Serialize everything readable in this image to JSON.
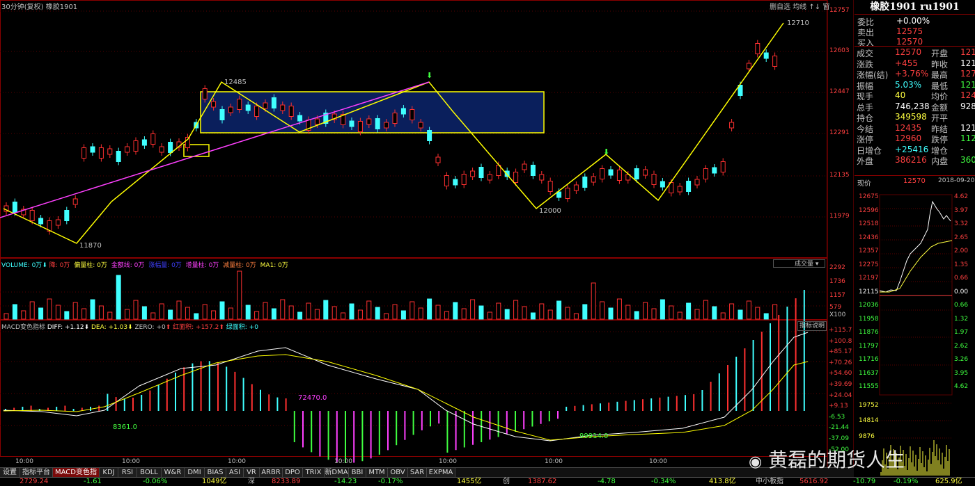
{
  "header": {
    "period": "30分钟(复权)",
    "symbol": "橡胶1901",
    "buttons": [
      "删自选",
      "均线",
      "↑↓",
      "窗"
    ]
  },
  "price_axis": [
    "12757",
    "12603",
    "12447",
    "12291",
    "12135",
    "11979"
  ],
  "chart_labels": {
    "high": "12710",
    "h1": "12485",
    "low1": "11870",
    "low2": "12000"
  },
  "volume": {
    "label": "VOLUME: 0万",
    "items": [
      {
        "text": "降: 0万",
        "color": "#ff4040"
      },
      {
        "text": "偏量柱: 0万",
        "color": "#ffff40"
      },
      {
        "text": "金额线: 0万",
        "color": "#ff40ff"
      },
      {
        "text": "涨幅量: 0万",
        "color": "#4040ff"
      },
      {
        "text": "增量柱: 0万",
        "color": "#ff40ff"
      },
      {
        "text": "减量柱: 0万",
        "color": "#ff8040"
      },
      {
        "text": "MA1: 0万",
        "color": "#ffff40"
      }
    ],
    "dropdown": "成交量",
    "axis": [
      "2292",
      "1736",
      "1157",
      "579",
      "X100"
    ]
  },
  "macd": {
    "title": "MACD变色指标",
    "diff": "DIFF: +1.12",
    "dea": "DEA: +1.03",
    "zero": "ZERO: +0",
    "red_area": "红面积: +157.2",
    "green_area": "绿面积: +0",
    "help": "指标说明",
    "axis": [
      "+115.7",
      "+100.8",
      "+85.17",
      "+70.26",
      "+54.60",
      "+39.69",
      "+24.04",
      "+9.13",
      "-6.53",
      "-21.44",
      "-37.09",
      "-52.00"
    ],
    "annotations": [
      "72470.0",
      "8361.0",
      "99914.0"
    ]
  },
  "time_axis": [
    "10:00",
    "10:00",
    "10:00",
    "10:00",
    "10:00",
    "10:00",
    "10:00"
  ],
  "tabs": [
    "设置",
    "指标平台",
    "MACD变色指标",
    "KDJ",
    "RSI",
    "BOLL",
    "W&R",
    "DMI",
    "BIAS",
    "ASI",
    "VR",
    "ARBR",
    "DPO",
    "TRIX",
    "新DMA",
    "BBI",
    "MTM",
    "OBV",
    "SAR",
    "EXPMA"
  ],
  "quote": {
    "title": "橡胶1901 ru1901",
    "top": [
      {
        "label": "委比",
        "value": "+0.00%",
        "vcolor": "#ffffff"
      },
      {
        "label": "卖出",
        "value": "12575",
        "vcolor": "#ff4040"
      },
      {
        "label": "买入",
        "value": "12570",
        "vcolor": "#ff4040"
      }
    ],
    "rows": [
      {
        "l1": "成交",
        "v1": "12570",
        "c1": "#ff4040",
        "l2": "开盘",
        "v2": "121",
        "c2": "#ff4040"
      },
      {
        "l1": "涨跌",
        "v1": "+455",
        "c1": "#ff4040",
        "l2": "昨收",
        "v2": "121",
        "c2": "#ffffff"
      },
      {
        "l1": "涨幅(结)",
        "v1": "+3.76%",
        "c1": "#ff4040",
        "l2": "最高",
        "v2": "127",
        "c2": "#ff4040"
      },
      {
        "l1": "振幅",
        "v1": "5.03%",
        "c1": "#40ffff",
        "l2": "最低",
        "v2": "121",
        "c2": "#40ff40"
      },
      {
        "l1": "现手",
        "v1": "40",
        "c1": "#ffff40",
        "l2": "均价",
        "v2": "124",
        "c2": "#ff4040"
      },
      {
        "l1": "总手",
        "v1": "746,238",
        "c1": "#ffffff",
        "l2": "金额",
        "v2": "928.3",
        "c2": "#ffffff"
      },
      {
        "l1": "持仓",
        "v1": "349598",
        "c1": "#ffff40",
        "l2": "开平",
        "v2": "",
        "c2": "#ffffff"
      },
      {
        "l1": "今结",
        "v1": "12435",
        "c1": "#ff4040",
        "l2": "昨结",
        "v2": "121",
        "c2": "#ffffff"
      },
      {
        "l1": "涨停",
        "v1": "12960",
        "c1": "#ff4040",
        "l2": "跌停",
        "v2": "112",
        "c2": "#40ff40"
      },
      {
        "l1": "日增仓",
        "v1": "+25416",
        "c1": "#40ffff",
        "l2": "增仓",
        "v2": "-",
        "c2": "#ffffff"
      },
      {
        "l1": "外盘",
        "v1": "386216",
        "c1": "#ff4040",
        "l2": "内盘",
        "v2": "3600",
        "c2": "#40ff40"
      }
    ],
    "current_label": "现价",
    "current_value": "12570",
    "date": "2018-09-20",
    "mini_left": [
      "12675",
      "12596",
      "12518",
      "12436",
      "12357",
      "12275",
      "12197",
      "12115",
      "12036",
      "11958",
      "11876",
      "11797",
      "11716",
      "11637",
      "11555"
    ],
    "mini_right": [
      "4.62",
      "3.97",
      "3.32",
      "2.65",
      "2.00",
      "1.35",
      "0.66",
      "0.00",
      "0.66",
      "1.32",
      "1.97",
      "2.62",
      "3.26",
      "3.95",
      "4.62"
    ],
    "mini_vol": [
      "19752",
      "14814",
      "9876"
    ]
  },
  "status_bar": [
    {
      "text": "2729.24",
      "color": "#ff4040"
    },
    {
      "text": "-1.61",
      "color": "#40ff40"
    },
    {
      "text": "-0.06%",
      "color": "#40ff40"
    },
    {
      "text": "1049亿",
      "color": "#ffff40"
    },
    {
      "text": "深",
      "color": "#c0c0c0"
    },
    {
      "text": "8233.89",
      "color": "#ff4040"
    },
    {
      "text": "-14.23",
      "color": "#40ff40"
    },
    {
      "text": "-0.17%",
      "color": "#40ff40"
    },
    {
      "text": "1455亿",
      "color": "#ffff40"
    },
    {
      "text": "创",
      "color": "#c0c0c0"
    },
    {
      "text": "1387.62",
      "color": "#ff4040"
    },
    {
      "text": "-4.78",
      "color": "#40ff40"
    },
    {
      "text": "-0.34%",
      "color": "#40ff40"
    },
    {
      "text": "413.8亿",
      "color": "#ffff40"
    },
    {
      "text": "中小板指",
      "color": "#c0c0c0"
    },
    {
      "text": "5616.92",
      "color": "#ff4040"
    },
    {
      "text": "-10.79",
      "color": "#40ff40"
    },
    {
      "text": "-0.19%",
      "color": "#40ff40"
    },
    {
      "text": "625.9亿",
      "color": "#ffff40"
    }
  ],
  "watermark": "黄磊的期货人生"
}
